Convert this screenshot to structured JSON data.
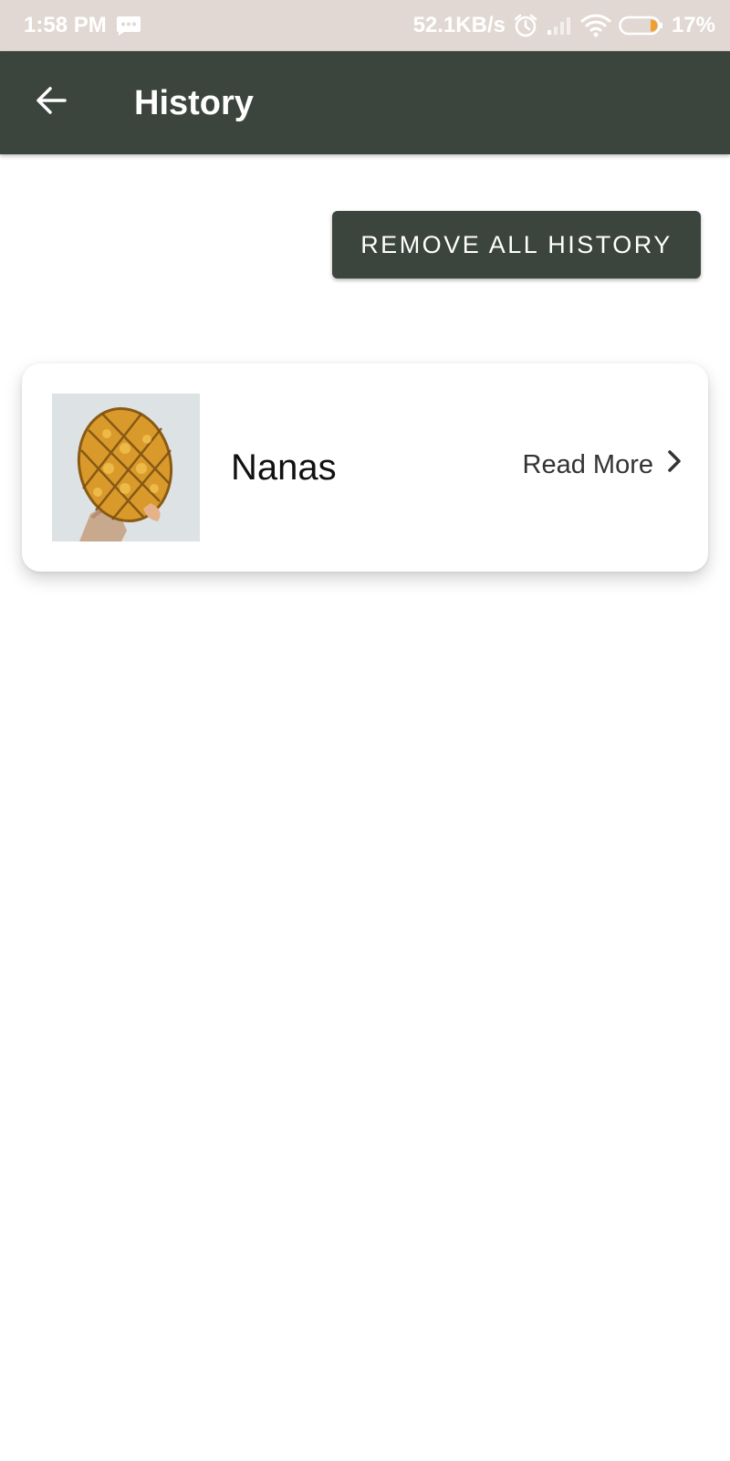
{
  "status_bar": {
    "time": "1:58 PM",
    "network_speed": "52.1KB/s",
    "battery_percent": "17%",
    "battery_level": 0.17,
    "icons": [
      "message-icon",
      "alarm-icon",
      "signal-icon",
      "wifi-icon",
      "battery-icon"
    ]
  },
  "app_bar": {
    "title": "History",
    "back_icon": "arrow-back-icon",
    "color": "#3c443e"
  },
  "actions": {
    "remove_all_label": "REMOVE ALL HISTORY"
  },
  "history": {
    "items": [
      {
        "name": "Nanas",
        "read_more_label": "Read More",
        "image": "pineapple-photo",
        "chevron_icon": "chevron-right-icon"
      }
    ]
  }
}
